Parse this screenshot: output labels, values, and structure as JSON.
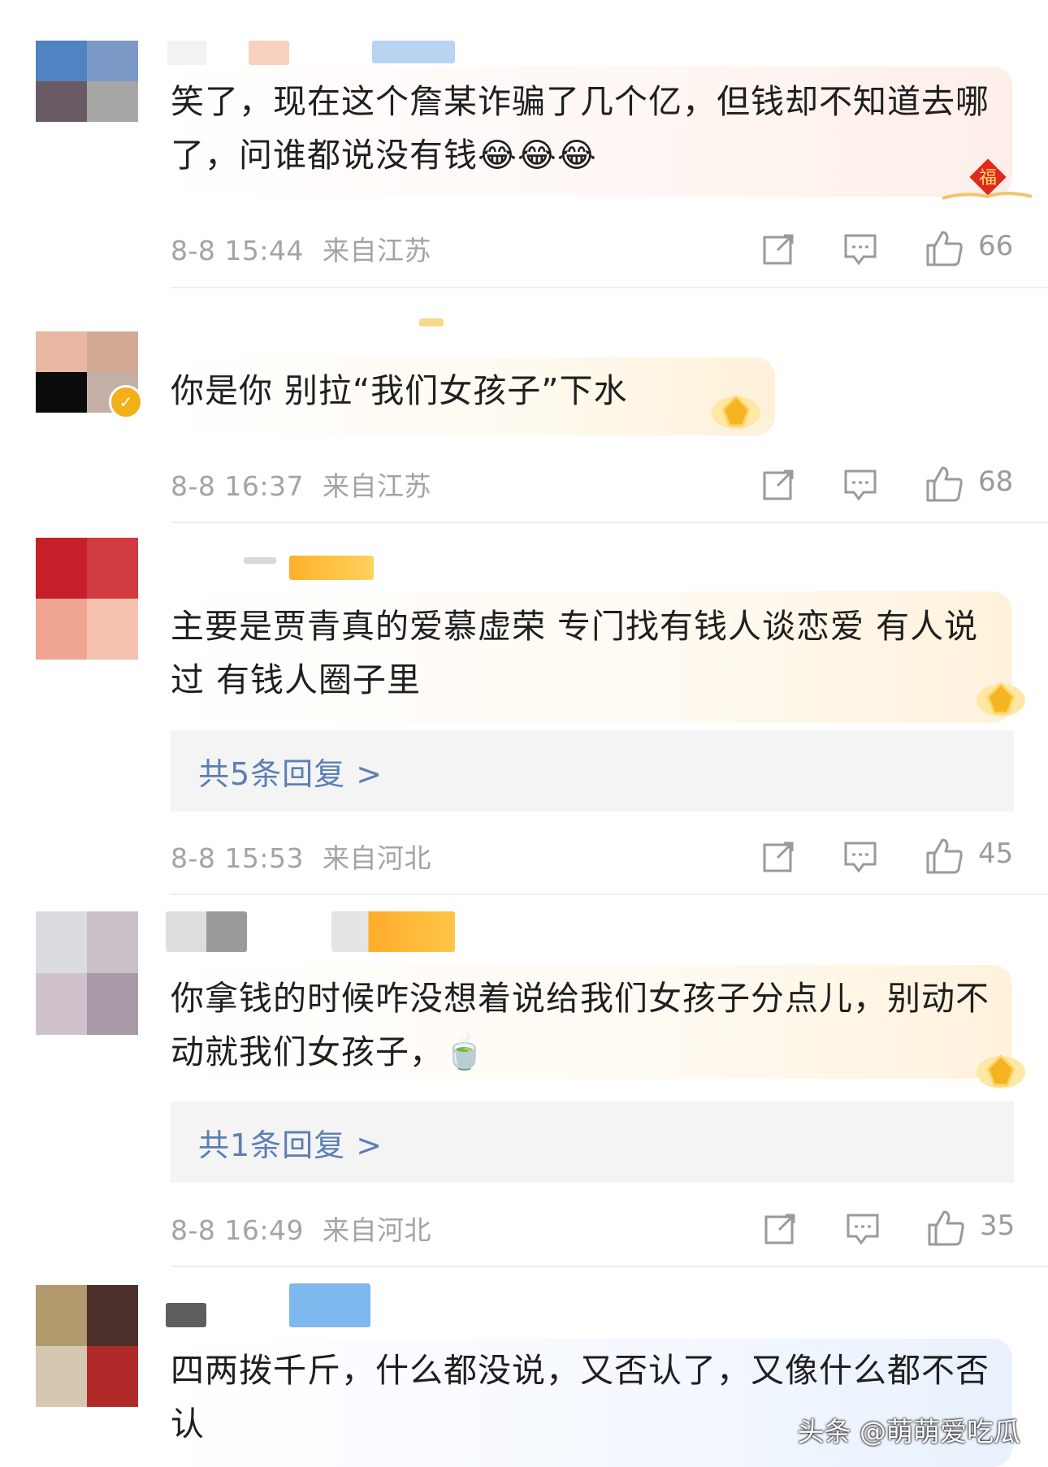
{
  "comments": [
    {
      "text": "笑了，现在这个詹某诈骗了几个亿，但钱却不知道去哪了，问谁都说没有钱😂😂😂",
      "time": "8-8 15:44",
      "location": "来自江苏",
      "likes": "66",
      "replies_label": ""
    },
    {
      "text": "你是你 别拉“我们女孩子”下水",
      "time": "8-8 16:37",
      "location": "来自江苏",
      "likes": "68",
      "replies_label": ""
    },
    {
      "text": "主要是贾青真的爱慕虚荣 专门找有钱人谈恋爱 有人说过 有钱人圈子里",
      "time": "8-8 15:53",
      "location": "来自河北",
      "likes": "45",
      "replies_label": "共5条回复 >"
    },
    {
      "text": "你拿钱的时候咋没想着说给我们女孩子分点儿，别动不动就我们女孩子，🍵",
      "time": "8-8 16:49",
      "location": "来自河北",
      "likes": "35",
      "replies_label": "共1条回复 >"
    },
    {
      "text": "四两拨千斤，什么都没说，又否认了，又像什么都不否认",
      "time": "",
      "location": "",
      "likes": "",
      "replies_label": ""
    }
  ],
  "badges": {
    "fu_char": "福",
    "verified_mark": "✓"
  },
  "watermark": "头条 @萌萌爱吃瓜",
  "icons": [
    "share-icon",
    "comment-icon",
    "like-icon",
    "fu-badge-icon",
    "gold-crown-icon"
  ],
  "colors": {
    "reply_link": "#5a7fb5",
    "meta_gray": "#a4a4a4",
    "reply_bg": "#f4f4f4"
  }
}
